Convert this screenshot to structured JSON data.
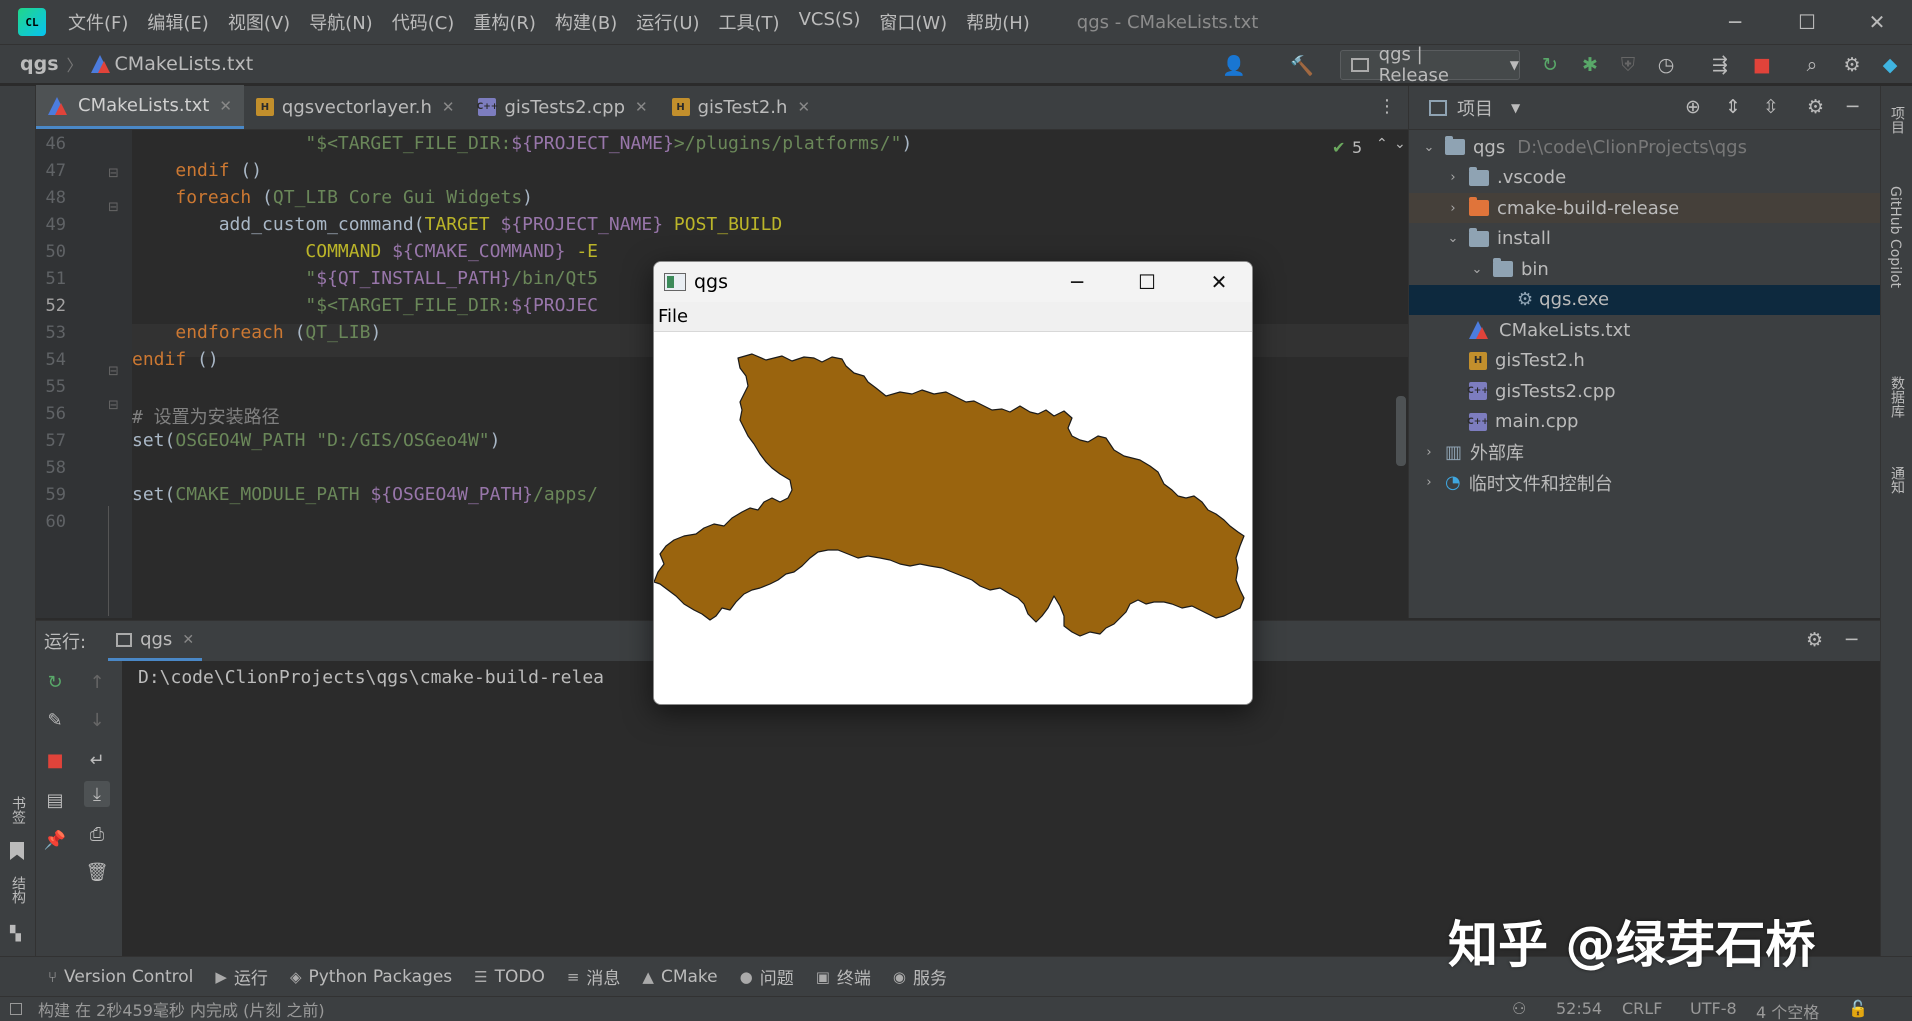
{
  "title_bar": {
    "logo": "CL",
    "menu": [
      "文件(F)",
      "编辑(E)",
      "视图(V)",
      "导航(N)",
      "代码(C)",
      "重构(R)",
      "构建(B)",
      "运行(U)",
      "工具(T)",
      "VCS(S)",
      "窗口(W)",
      "帮助(H)"
    ],
    "window_title": "qgs - CMakeLists.txt"
  },
  "nav": {
    "project": "qgs",
    "file": "CMakeLists.txt",
    "run_config": "qgs | Release"
  },
  "tabs": [
    {
      "label": "CMakeLists.txt",
      "type": "cmake",
      "active": true
    },
    {
      "label": "qgsvectorlayer.h",
      "type": "h",
      "active": false
    },
    {
      "label": "gisTests2.cpp",
      "type": "cpp",
      "active": false
    },
    {
      "label": "gisTest2.h",
      "type": "h",
      "active": false
    }
  ],
  "editor": {
    "inspection_count": "5",
    "current_line": 52,
    "lines": [
      {
        "n": "46",
        "html": "                <span class=\"str\">\"$&lt;TARGET_FILE_DIR:</span><span class=\"var\">${PROJECT_NAME}</span><span class=\"str\">&gt;/plugins/platforms/\"</span>)"
      },
      {
        "n": "47",
        "html": "    <span class=\"kw\">endif</span> ()"
      },
      {
        "n": "48",
        "html": "    <span class=\"kw\">foreach</span> (<span class=\"str\">QT_LIB Core Gui Widgets</span>)"
      },
      {
        "n": "49",
        "html": "        add_custom_command(<span class=\"arg\">TARGET</span> <span class=\"var\">${PROJECT_NAME}</span> <span class=\"arg\">POST_BUILD</span>"
      },
      {
        "n": "50",
        "html": "                <span class=\"arg\">COMMAND</span> <span class=\"var\">${CMAKE_COMMAND}</span> <span class=\"arg\">-E</span>"
      },
      {
        "n": "51",
        "html": "                <span class=\"str\">\"</span><span class=\"var\">${QT_INSTALL_PATH}</span><span class=\"str\">/bin/Qt5</span>"
      },
      {
        "n": "52",
        "html": "                <span class=\"str\">\"$&lt;TARGET_FILE_DIR:</span><span class=\"var\">${PROJEC</span>"
      },
      {
        "n": "53",
        "html": "    <span class=\"kw\">endforeach</span> (<span class=\"str\">QT_LIB</span>)"
      },
      {
        "n": "54",
        "html": "<span class=\"kw\">endif</span> ()"
      },
      {
        "n": "55",
        "html": ""
      },
      {
        "n": "56",
        "html": "<span class=\"cmt\"># 设置为安装路径</span>"
      },
      {
        "n": "57",
        "html": "set(<span class=\"str\">OSGEO4W_PATH</span> <span class=\"str\">\"D:/GIS/OSGeo4W\"</span>)"
      },
      {
        "n": "58",
        "html": ""
      },
      {
        "n": "59",
        "html": "set(<span class=\"str\">CMAKE_MODULE_PATH</span> <span class=\"var\">${OSGEO4W_PATH}</span><span class=\"str\">/apps/</span>"
      },
      {
        "n": "60",
        "html": ""
      }
    ]
  },
  "project_panel": {
    "title": "项目",
    "tree": [
      {
        "indent": 0,
        "chev": "v",
        "icon": "folder",
        "label": "qgs",
        "extra": "D:\\code\\ClionProjects\\qgs",
        "state": ""
      },
      {
        "indent": 1,
        "chev": ">",
        "icon": "folder",
        "label": ".vscode",
        "extra": "",
        "state": ""
      },
      {
        "indent": 1,
        "chev": ">",
        "icon": "folder-orange",
        "label": "cmake-build-release",
        "extra": "",
        "state": "hl"
      },
      {
        "indent": 1,
        "chev": "v",
        "icon": "folder",
        "label": "install",
        "extra": "",
        "state": ""
      },
      {
        "indent": 2,
        "chev": "v",
        "icon": "folder",
        "label": "bin",
        "extra": "",
        "state": ""
      },
      {
        "indent": 3,
        "chev": "",
        "icon": "exe",
        "label": "qgs.exe",
        "extra": "",
        "state": "sel"
      },
      {
        "indent": 1,
        "chev": "",
        "icon": "cmake",
        "label": "CMakeLists.txt",
        "extra": "",
        "state": ""
      },
      {
        "indent": 1,
        "chev": "",
        "icon": "h",
        "label": "gisTest2.h",
        "extra": "",
        "state": ""
      },
      {
        "indent": 1,
        "chev": "",
        "icon": "cpp",
        "label": "gisTests2.cpp",
        "extra": "",
        "state": ""
      },
      {
        "indent": 1,
        "chev": "",
        "icon": "cpp",
        "label": "main.cpp",
        "extra": "",
        "state": ""
      },
      {
        "indent": 0,
        "chev": ">",
        "icon": "lib",
        "label": "外部库",
        "extra": "",
        "state": ""
      },
      {
        "indent": 0,
        "chev": ">",
        "icon": "scratch",
        "label": "临时文件和控制台",
        "extra": "",
        "state": ""
      }
    ]
  },
  "right_strip": [
    "项目",
    "GitHub Copilot",
    "数据库",
    "通知"
  ],
  "left_strip": [
    "书签",
    "结构"
  ],
  "run_panel": {
    "label": "运行:",
    "tab": "qgs",
    "console": "D:\\code\\ClionProjects\\qgs\\cmake-build-relea"
  },
  "bottom_tabs": [
    {
      "label": "Version Control",
      "icon": "⑂"
    },
    {
      "label": "运行",
      "icon": "▶"
    },
    {
      "label": "Python Packages",
      "icon": "◈"
    },
    {
      "label": "TODO",
      "icon": "☰"
    },
    {
      "label": "消息",
      "icon": "≡"
    },
    {
      "label": "CMake",
      "icon": "▲"
    },
    {
      "label": "问题",
      "icon": "●"
    },
    {
      "label": "终端",
      "icon": "▣"
    },
    {
      "label": "服务",
      "icon": "◉"
    }
  ],
  "status": {
    "message": "构建 在 2秒459毫秒 内完成 (片刻 之前)",
    "position": "52:54",
    "line_ending": "CRLF",
    "encoding": "UTF-8",
    "indent": "4 个空格"
  },
  "watermark": "知乎 @绿芽石桥",
  "qgs_window": {
    "title": "qgs",
    "menu_file": "File",
    "fill_color": "#9a640e"
  }
}
